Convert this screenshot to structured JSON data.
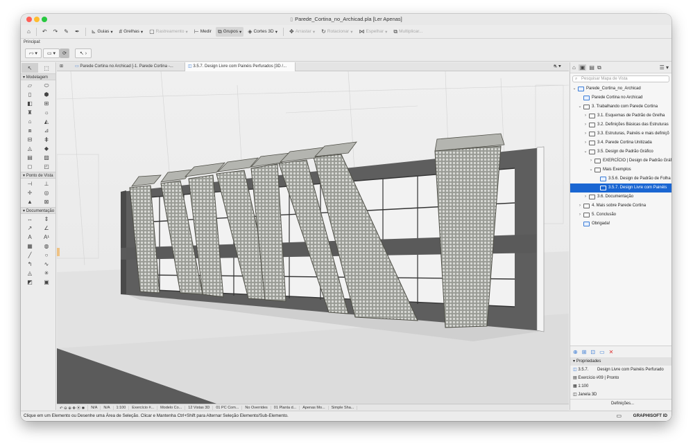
{
  "window": {
    "title": "Parede_Cortina_no_Archicad.pla [Ler Apenas]"
  },
  "toolbar": {
    "guias": "Guias",
    "grelhas": "Grelhas",
    "rastreamento": "Rastreamento",
    "medir": "Medir",
    "grupos": "Grupos",
    "cortes3d": "Cortes 3D",
    "arrastar": "Arrastar",
    "rotacionar": "Rotacionar",
    "espelhar": "Espelhar",
    "multiplicar": "Multiplicar..."
  },
  "info_box": {
    "label": "Principal:"
  },
  "toolbox": {
    "sections": [
      "Modelagem",
      "Ponto de Vista",
      "Documentação"
    ]
  },
  "tabs": [
    {
      "label": "Parede Cortina no Archicad [-1. Parede Cortina -..."
    },
    {
      "label": "3.5.7. Design Livre com Painéis Perfurados [3D /..."
    }
  ],
  "navigator": {
    "search_placeholder": "Pesquisar Mapa de Vista",
    "items": [
      {
        "label": "Parede_Cortina_no_Archicad",
        "level": 0,
        "arrow": "⌄",
        "icon": "project"
      },
      {
        "label": "Parede Cortina no Archicad",
        "level": 1,
        "arrow": "",
        "icon": "view"
      },
      {
        "label": "3. Trabalhando com Parede Cortina",
        "level": 1,
        "arrow": "⌄",
        "icon": "folder"
      },
      {
        "label": "3.1. Esquemas de Padrão de Grelha",
        "level": 2,
        "arrow": "›",
        "icon": "folder"
      },
      {
        "label": "3.2. Definições Básicas das Estruturas",
        "level": 2,
        "arrow": "›",
        "icon": "folder"
      },
      {
        "label": "3.3. Estruturas, Painéis e mais definiçõ",
        "level": 2,
        "arrow": "›",
        "icon": "folder"
      },
      {
        "label": "3.4. Parede Cortina Unitizada",
        "level": 2,
        "arrow": "›",
        "icon": "folder"
      },
      {
        "label": "3.5. Design de Padrão Gráfico",
        "level": 2,
        "arrow": "⌄",
        "icon": "folder"
      },
      {
        "label": "EXERCÍCIO | Design de Padrão Gráf",
        "level": 3,
        "arrow": "›",
        "icon": "folder"
      },
      {
        "label": "Mais Exemplos",
        "level": 3,
        "arrow": "⌄",
        "icon": "folder"
      },
      {
        "label": "3.5.6. Design de Padrão de Folha",
        "level": 4,
        "arrow": "",
        "icon": "view"
      },
      {
        "label": "3.5.7. Design Livre com Painéis",
        "level": 4,
        "arrow": "",
        "icon": "view",
        "selected": true
      },
      {
        "label": "3.6. Documentação",
        "level": 2,
        "arrow": "›",
        "icon": "folder"
      },
      {
        "label": "4. Mais sobre Parede Cortina",
        "level": 1,
        "arrow": "›",
        "icon": "folder"
      },
      {
        "label": "5. Conclusão",
        "level": 1,
        "arrow": "›",
        "icon": "folder"
      },
      {
        "label": "Obrigada!",
        "level": 1,
        "arrow": "",
        "icon": "view"
      }
    ]
  },
  "properties": {
    "header": "Propriedades",
    "id": "3.5.7.",
    "name": "Design Livre com Painéis Perfurado",
    "layer_combo": "Exercício #09 | Pronto",
    "scale": "1:100",
    "window": "Janela 3D",
    "settings_button": "Definições..."
  },
  "status_strip": {
    "items": [
      "N/A",
      "N/A",
      "1:100",
      "Exercício #...",
      "Modelo Co...",
      "12 Vistas 3D",
      "01 PC Com...",
      "No Overrides",
      "01 Planta d...",
      "Apenas Mo...",
      "Simple Sha..."
    ]
  },
  "message": "Clique em um Elemento ou Desenhe uma Área de Seleção. Clicar e Mantenha Ctrl+Shift para Alternar Seleção Elemento/Sub-Elemento.",
  "brand": "GRAPHISOFT ID",
  "colors": {
    "selection": "#1a66d2",
    "frame": "#5a5a5a",
    "panel_mesh": "#8a8d86"
  }
}
